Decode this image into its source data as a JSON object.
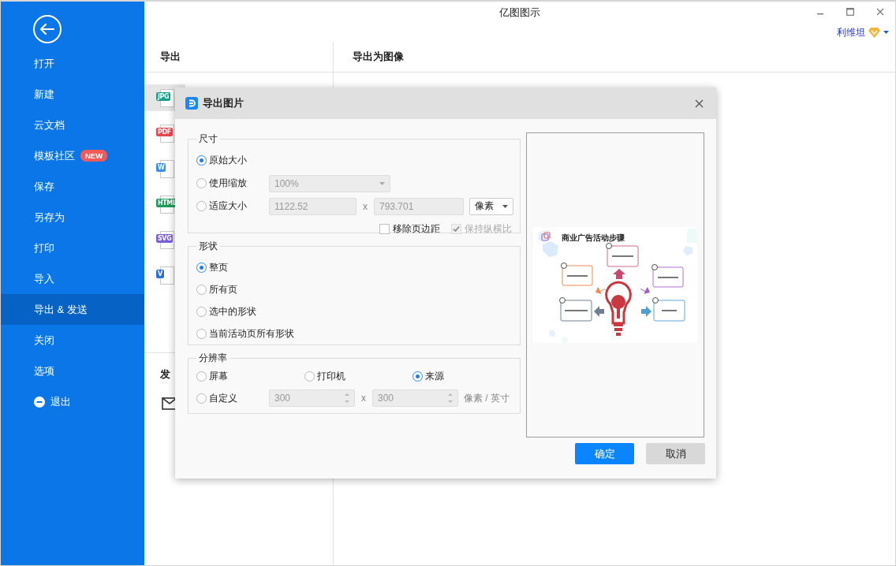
{
  "window": {
    "title": "亿图图示",
    "user": "利维坦"
  },
  "sidebar": {
    "items": [
      {
        "label": "打开",
        "kind": "plain",
        "selected": false
      },
      {
        "label": "新建",
        "kind": "plain",
        "selected": false
      },
      {
        "label": "云文档",
        "kind": "plain",
        "selected": false
      },
      {
        "label": "模板社区",
        "kind": "plain",
        "badge": "NEW",
        "selected": false
      },
      {
        "label": "保存",
        "kind": "plain",
        "selected": false
      },
      {
        "label": "另存为",
        "kind": "plain",
        "selected": false
      },
      {
        "label": "打印",
        "kind": "plain",
        "selected": false
      },
      {
        "label": "导入",
        "kind": "plain",
        "selected": false
      },
      {
        "label": "导出 & 发送",
        "kind": "plain",
        "selected": true
      },
      {
        "label": "关闭",
        "kind": "plain",
        "selected": false
      },
      {
        "label": "选项",
        "kind": "plain",
        "selected": false
      },
      {
        "label": "退出",
        "kind": "exit",
        "selected": false
      }
    ]
  },
  "export_panel": {
    "title": "导出",
    "formats": [
      {
        "badge": "JPG",
        "color": "#1aa08a",
        "selected": true
      },
      {
        "badge": "PDF",
        "color": "#e8474f",
        "selected": false
      },
      {
        "badge": "W",
        "color": "#3a8ee6",
        "selected": false
      },
      {
        "badge": "HTML",
        "color": "#1e9c5c",
        "selected": false
      },
      {
        "badge": "SVG",
        "color": "#7b5fd6",
        "selected": false
      },
      {
        "badge": "V",
        "color": "#2a6fd6",
        "selected": false
      }
    ],
    "send_title": "发"
  },
  "content": {
    "title": "导出为图像"
  },
  "dialog": {
    "title": "导出图片",
    "size": {
      "title": "尺寸",
      "options": [
        {
          "label": "原始大小",
          "selected": true
        },
        {
          "label": "使用缩放",
          "selected": false
        },
        {
          "label": "适应大小",
          "selected": false
        }
      ],
      "scale": {
        "value": "100%",
        "disabled": true
      },
      "width": {
        "value": "1122.52",
        "disabled": true
      },
      "times": "x",
      "height": {
        "value": "793.701",
        "disabled": true
      },
      "unit": "像素",
      "checkboxes": [
        {
          "label": "移除页边距",
          "checked": false,
          "disabled": false
        },
        {
          "label": "保持纵横比",
          "checked": true,
          "disabled": true
        }
      ]
    },
    "shape": {
      "title": "形状",
      "options": [
        {
          "label": "整页",
          "selected": true
        },
        {
          "label": "所有页",
          "selected": false
        },
        {
          "label": "选中的形状",
          "selected": false
        },
        {
          "label": "当前活动页所有形状",
          "selected": false
        }
      ]
    },
    "resolution": {
      "title": "分辨率",
      "options": [
        {
          "label": "屏幕",
          "selected": false
        },
        {
          "label": "打印机",
          "selected": false
        },
        {
          "label": "来源",
          "selected": true
        },
        {
          "label": "自定义",
          "selected": false
        }
      ],
      "dpi_x": {
        "value": "300",
        "disabled": true
      },
      "times": "x",
      "dpi_y": {
        "value": "300",
        "disabled": true
      },
      "unit": "像素 / 英寸"
    },
    "preview": {
      "title": "商业广告活动步骤"
    },
    "buttons": [
      {
        "label": "确定",
        "kind": "primary"
      },
      {
        "label": "取消",
        "kind": "secondary"
      }
    ]
  }
}
